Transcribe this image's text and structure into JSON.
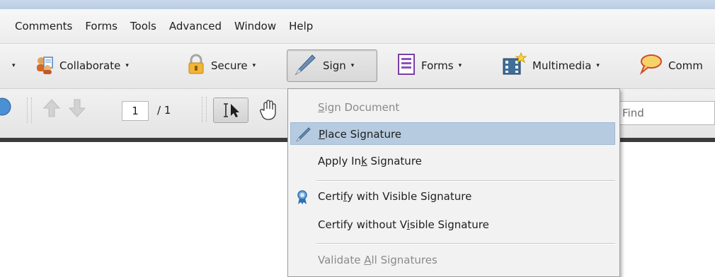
{
  "menubar": {
    "items": [
      "Comments",
      "Forms",
      "Tools",
      "Advanced",
      "Window",
      "Help"
    ]
  },
  "toolbar": {
    "cut_caret": "▾",
    "collaborate": "Collaborate",
    "secure": "Secure",
    "sign": "Sign",
    "forms": "Forms",
    "multimedia": "Multimedia",
    "comment_partial": "Comm"
  },
  "navbar": {
    "page_number": "1",
    "page_total": "/ 1",
    "find_placeholder": "Find"
  },
  "sign_menu": {
    "items": [
      {
        "pre": "",
        "u": "S",
        "post": "ign Document",
        "state": "disabled"
      },
      {
        "pre": "",
        "u": "P",
        "post": "lace Signature",
        "state": "highlighted"
      },
      {
        "pre": "Apply In",
        "u": "k",
        "post": " Signature",
        "state": "normal"
      },
      {
        "pre": "Certi",
        "u": "f",
        "post": "y with Visible Signature",
        "state": "normal"
      },
      {
        "pre": "Certify without V",
        "u": "i",
        "post": "sible Signature",
        "state": "normal"
      },
      {
        "pre": "Validate ",
        "u": "A",
        "post": "ll Signatures",
        "state": "disabled"
      }
    ]
  },
  "colors": {
    "highlight": "#b6cbdf",
    "menu_bg": "#f2f2f2",
    "disabled_text": "#8a8a8a"
  }
}
